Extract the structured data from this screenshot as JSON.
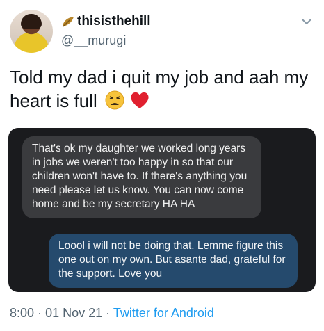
{
  "author": {
    "display_name": "thisisthehill",
    "handle": "@__murugi",
    "badge_icon": "leaf-icon"
  },
  "tweet": {
    "text": "Told my dad i quit my job and aah my heart is full",
    "emojis": [
      "tired-face",
      "red-heart"
    ]
  },
  "media": {
    "messages": [
      {
        "direction": "incoming",
        "text": "That's ok my daughter we worked long years in jobs we weren't too happy in so that our children won't have to. If there's anything you need please let us know. You can now come home and be my secretary HA HA"
      },
      {
        "direction": "outgoing",
        "text": "Loool i will not be doing that. Lemme figure this one out on my own. But asante dad, grateful for the support. Love you"
      }
    ]
  },
  "meta": {
    "time": "8:00",
    "separator": "·",
    "date": "01 Nov 21",
    "source": "Twitter for Android"
  },
  "colors": {
    "source_link": "#1d9bf0",
    "incoming_bubble": "#3a3b3e",
    "outgoing_bubble": "#254a6d",
    "media_background": "#1a1b1e"
  }
}
